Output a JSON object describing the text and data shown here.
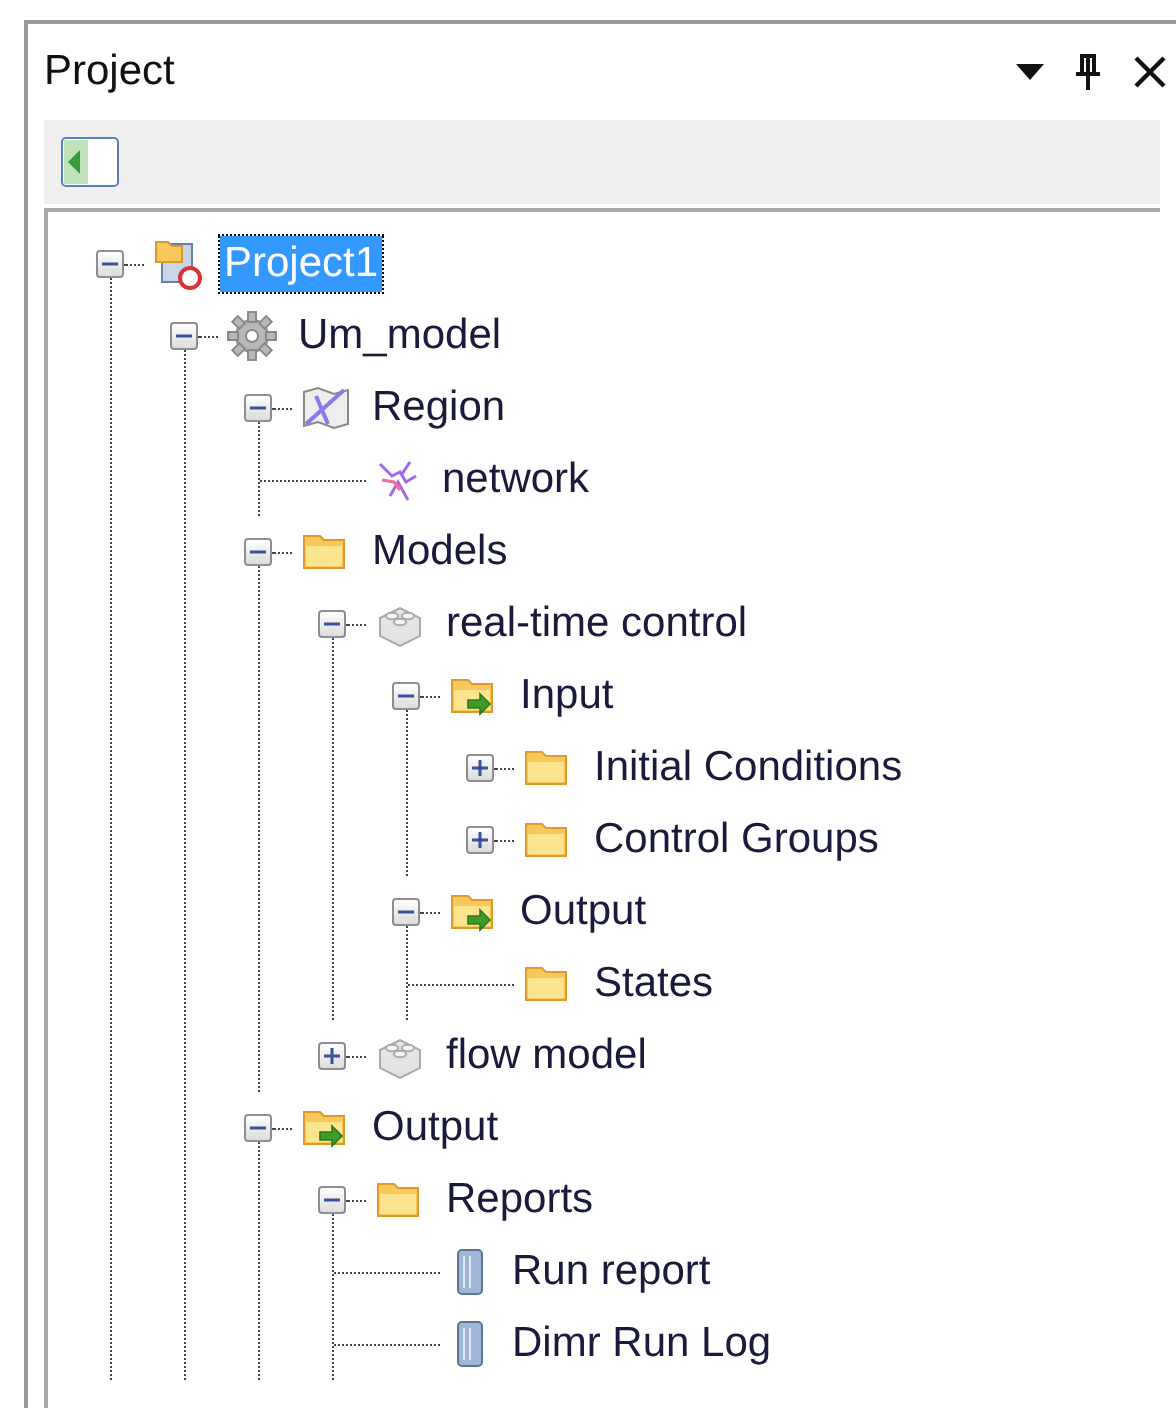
{
  "panel": {
    "title": "Project"
  },
  "tree": [
    {
      "label": "Project1",
      "kind": "project",
      "selected": true,
      "expanded": true,
      "children": [
        {
          "label": "Um_model",
          "kind": "gear",
          "selected": false,
          "expanded": true,
          "children": [
            {
              "label": "Region",
              "kind": "region",
              "selected": false,
              "expanded": true,
              "children": [
                {
                  "label": "network",
                  "kind": "network",
                  "selected": false
                }
              ]
            },
            {
              "label": "Models",
              "kind": "folder",
              "selected": false,
              "expanded": true,
              "children": [
                {
                  "label": "real-time control",
                  "kind": "model",
                  "selected": false,
                  "expanded": true,
                  "children": [
                    {
                      "label": "Input",
                      "kind": "folder-in",
                      "selected": false,
                      "expanded": true,
                      "children": [
                        {
                          "label": "Initial Conditions",
                          "kind": "folder",
                          "selected": false,
                          "expanded": false
                        },
                        {
                          "label": "Control Groups",
                          "kind": "folder",
                          "selected": false,
                          "expanded": false
                        }
                      ]
                    },
                    {
                      "label": "Output",
                      "kind": "folder-out",
                      "selected": false,
                      "expanded": true,
                      "children": [
                        {
                          "label": "States",
                          "kind": "folder",
                          "selected": false
                        }
                      ]
                    }
                  ]
                },
                {
                  "label": "flow model",
                  "kind": "model",
                  "selected": false,
                  "expanded": false
                }
              ]
            },
            {
              "label": "Output",
              "kind": "folder-out",
              "selected": false,
              "expanded": true,
              "children": [
                {
                  "label": "Reports",
                  "kind": "folder",
                  "selected": false,
                  "expanded": true,
                  "children": [
                    {
                      "label": "Run report",
                      "kind": "report",
                      "selected": false
                    },
                    {
                      "label": "Dimr Run Log",
                      "kind": "report",
                      "selected": false
                    }
                  ]
                }
              ]
            }
          ]
        }
      ]
    }
  ]
}
